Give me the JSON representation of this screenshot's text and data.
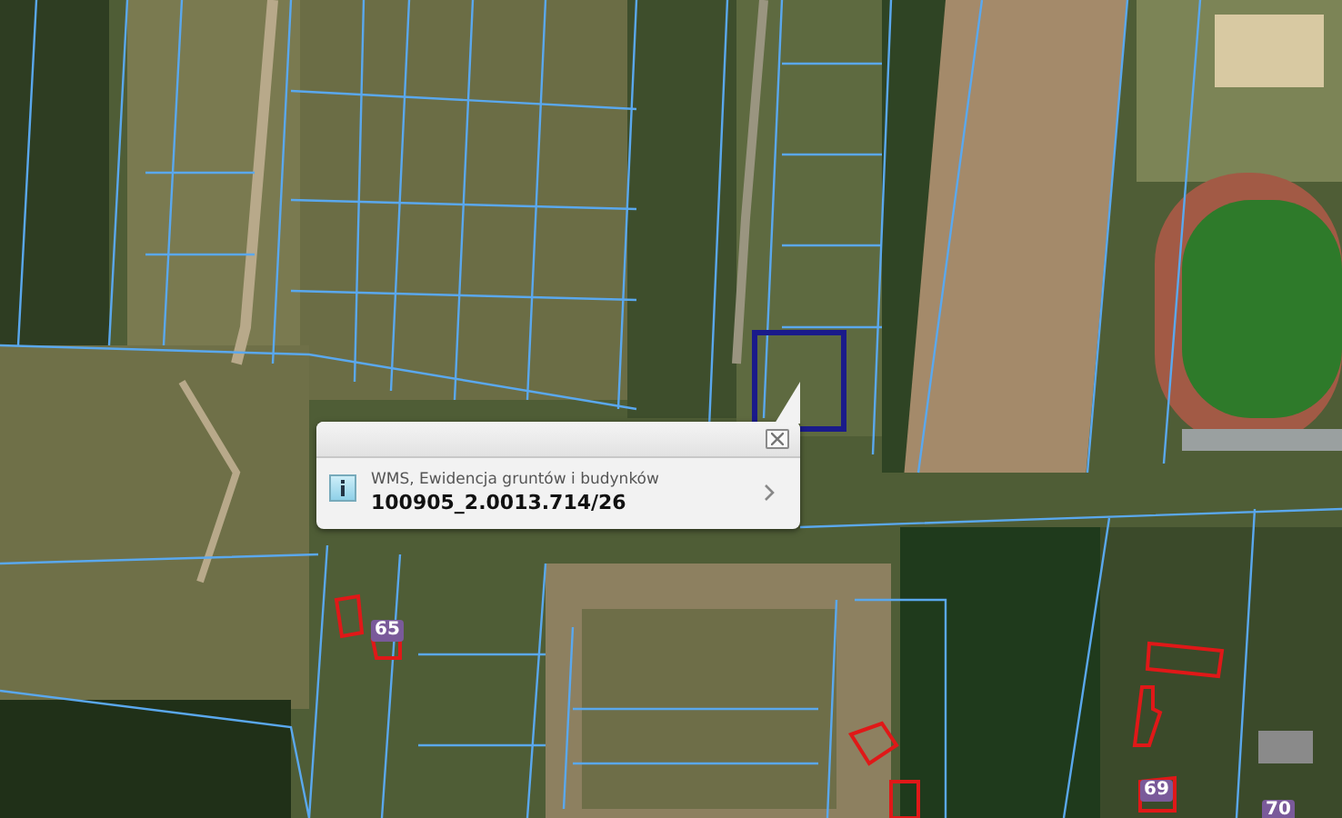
{
  "map": {
    "address_labels": [
      "65",
      "69",
      "70"
    ]
  },
  "popup": {
    "layer": "WMS, Ewidencja gruntów i budynków",
    "parcel_id": "100905_2.0013.714/26"
  }
}
